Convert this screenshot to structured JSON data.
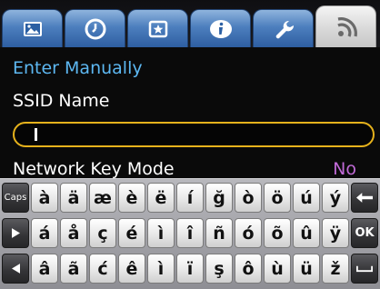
{
  "tabs": [
    {
      "name": "photo-icon",
      "active": false
    },
    {
      "name": "clock-icon",
      "active": false
    },
    {
      "name": "star-frame-icon",
      "active": false
    },
    {
      "name": "info-icon",
      "active": false
    },
    {
      "name": "wrench-icon",
      "active": false
    },
    {
      "name": "wifi-signal-icon",
      "active": true
    }
  ],
  "content": {
    "enter_manually": "Enter Manually",
    "ssid_label": "SSID Name",
    "ssid_value": "",
    "network_key_mode_label": "Network Key Mode",
    "network_key_mode_value": "No"
  },
  "keyboard": {
    "caps_label": "Caps",
    "ok_label": "OK",
    "row1": [
      "à",
      "ä",
      "æ",
      "è",
      "ë",
      "í",
      "ğ",
      "ò",
      "ö",
      "ú",
      "ý"
    ],
    "row2": [
      "á",
      "å",
      "ç",
      "é",
      "ì",
      "î",
      "ñ",
      "ó",
      "õ",
      "û",
      "ÿ"
    ],
    "row3": [
      "â",
      "ã",
      "ć",
      "ê",
      "ì",
      "ï",
      "ş",
      "ô",
      "ù",
      "ü",
      "ž"
    ]
  },
  "colors": {
    "highlight_text": "#5db8f2",
    "value_text": "#c06ad6",
    "input_border": "#e6b21c",
    "tab_blue": "#4d7fbe"
  }
}
